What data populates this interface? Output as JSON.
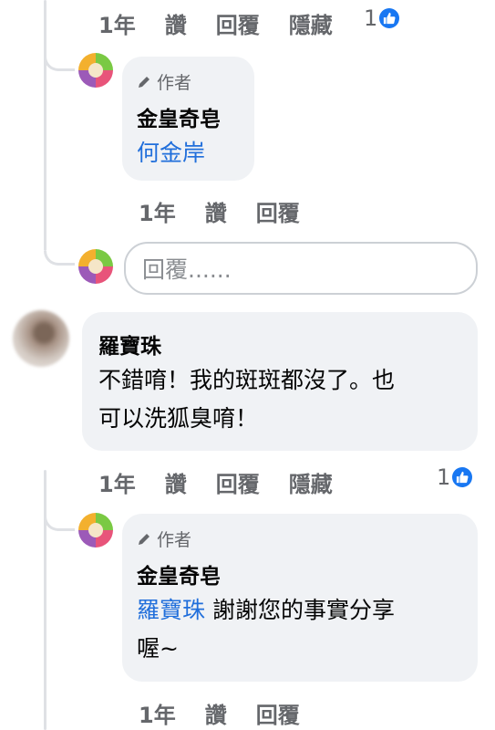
{
  "comment1": {
    "actions": {
      "time": "1年",
      "like": "讚",
      "reply": "回覆",
      "hide": "隱藏"
    },
    "reaction_count": "1"
  },
  "reply1": {
    "author_badge": "作者",
    "author_name": "金皇奇皂",
    "mention": "何金岸",
    "actions": {
      "time": "1年",
      "like": "讚",
      "reply": "回覆"
    }
  },
  "reply_input": {
    "placeholder": "回覆......"
  },
  "comment2": {
    "author_name": "羅寶珠",
    "text_line1": "不錯唷！我的斑斑都沒了。也",
    "text_line2": "可以洗狐臭唷！",
    "actions": {
      "time": "1年",
      "like": "讚",
      "reply": "回覆",
      "hide": "隱藏"
    },
    "reaction_count": "1"
  },
  "reply2": {
    "author_badge": "作者",
    "author_name": "金皇奇皂",
    "mention": "羅寶珠",
    "text_rest": " 謝謝您的事實分享",
    "text_line2": "喔~",
    "actions": {
      "time": "1年",
      "like": "讚",
      "reply": "回覆"
    }
  },
  "colors": {
    "like_blue": "#1877f2",
    "mention_blue": "#216fdb",
    "bubble_bg": "#f0f2f5"
  },
  "icons": {
    "pencil": "pencil-icon",
    "like": "like-icon"
  }
}
